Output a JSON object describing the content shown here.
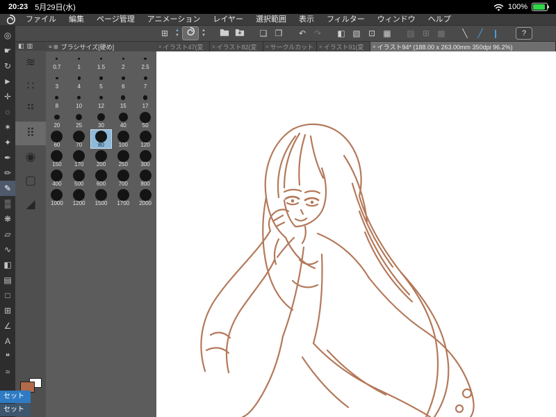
{
  "status_bar": {
    "time": "20:23",
    "date": "5月29日(水)",
    "battery_percent": "100%"
  },
  "menu_bar": {
    "items": [
      "ファイル",
      "編集",
      "ページ管理",
      "アニメーション",
      "レイヤー",
      "選択範囲",
      "表示",
      "フィルター",
      "ウィンドウ",
      "ヘルプ"
    ]
  },
  "toolbar": {
    "icons": [
      {
        "name": "palette-grid",
        "glyph": "⊞",
        "kind": "normal"
      },
      {
        "name": "tool-size-stepper",
        "glyph": "▲▼",
        "kind": "stepper",
        "accent": true
      },
      {
        "name": "current-tool-brush",
        "glyph": "logo",
        "kind": "active"
      },
      {
        "name": "brush-size-stepper",
        "glyph": "▲▼",
        "kind": "stepper"
      },
      {
        "name": "open-file",
        "glyph": "folder",
        "kind": "normal",
        "gap": true
      },
      {
        "name": "save-file",
        "glyph": "folder-arrow",
        "kind": "normal"
      },
      {
        "name": "new-page",
        "glyph": "❏",
        "kind": "normal",
        "gap": true
      },
      {
        "name": "duplicate-page",
        "glyph": "❐",
        "kind": "normal"
      },
      {
        "name": "undo",
        "glyph": "↶",
        "kind": "normal",
        "gap": true
      },
      {
        "name": "redo",
        "glyph": "↷",
        "kind": "dim"
      },
      {
        "name": "snap-ruler",
        "glyph": "◧",
        "kind": "normal",
        "gap": true
      },
      {
        "name": "snap-special-ruler",
        "glyph": "▧",
        "kind": "normal"
      },
      {
        "name": "snap-grid",
        "glyph": "⊡",
        "kind": "normal"
      },
      {
        "name": "material-palette",
        "glyph": "▦",
        "kind": "normal"
      },
      {
        "name": "selection-launcher",
        "glyph": "▨",
        "kind": "dim",
        "gap": true
      },
      {
        "name": "transform",
        "glyph": "⊞",
        "kind": "dim"
      },
      {
        "name": "mesh-transform",
        "glyph": "▩",
        "kind": "dim"
      },
      {
        "name": "line-tool",
        "glyph": "╲",
        "kind": "normal",
        "gap": true
      },
      {
        "name": "curve-tool",
        "glyph": "╱",
        "kind": "blue"
      },
      {
        "name": "pen-pressure",
        "glyph": "❙",
        "kind": "blue"
      }
    ],
    "help_label": "?"
  },
  "tabs": [
    {
      "label": "イラスト47(変",
      "active": false
    },
    {
      "label": "イラスト82(変",
      "active": false
    },
    {
      "label": "サークルカット",
      "active": false
    },
    {
      "label": "イラスト91(変",
      "active": false
    },
    {
      "label": "イラスト94* (188.00 x 263.00mm 350dpi 96.2%)",
      "active": true
    }
  ],
  "tool_palette": {
    "selected_index": 10,
    "tools": [
      {
        "name": "zoom",
        "glyph": "◎"
      },
      {
        "name": "hand",
        "glyph": "☛"
      },
      {
        "name": "rotate",
        "glyph": "↻"
      },
      {
        "name": "operate",
        "glyph": "►"
      },
      {
        "name": "move-layer",
        "glyph": "✛"
      },
      {
        "name": "lasso",
        "glyph": "◌"
      },
      {
        "name": "auto-select",
        "glyph": "✶"
      },
      {
        "name": "eyedropper",
        "glyph": "✦"
      },
      {
        "name": "pen",
        "glyph": "✒"
      },
      {
        "name": "pencil",
        "glyph": "✏"
      },
      {
        "name": "brush",
        "glyph": "✎"
      },
      {
        "name": "airbrush",
        "glyph": "▒"
      },
      {
        "name": "decoration",
        "glyph": "❋"
      },
      {
        "name": "eraser",
        "glyph": "▱"
      },
      {
        "name": "blend",
        "glyph": "∿"
      },
      {
        "name": "fill",
        "glyph": "◧"
      },
      {
        "name": "gradient",
        "glyph": "▤"
      },
      {
        "name": "figure",
        "glyph": "□"
      },
      {
        "name": "frame",
        "glyph": "⊞"
      },
      {
        "name": "ruler",
        "glyph": "∠"
      },
      {
        "name": "text",
        "glyph": "A"
      },
      {
        "name": "balloon",
        "glyph": "❝"
      },
      {
        "name": "correct-line",
        "glyph": "≈"
      }
    ]
  },
  "subtool_palette": {
    "selected_index": 3,
    "toggles": [
      "◧",
      "▥"
    ],
    "items": [
      {
        "name": "soft-pencil",
        "glyph": "≋"
      },
      {
        "name": "rough-pencil",
        "glyph": "∷"
      },
      {
        "name": "dot-brush-small",
        "glyph": "⠛"
      },
      {
        "name": "dot-brush-dense",
        "glyph": "⠿"
      },
      {
        "name": "round-brush",
        "glyph": "◉"
      },
      {
        "name": "flat-brush",
        "glyph": "▢"
      },
      {
        "name": "slanted-brush",
        "glyph": "◢"
      }
    ]
  },
  "brush_size_panel": {
    "title": "ブラシサイズ[硬め]",
    "header_icons": [
      "≡",
      "⊞"
    ],
    "selected_size": 80,
    "sizes": [
      0.7,
      1,
      1.5,
      2,
      2.5,
      3,
      4,
      5,
      6,
      7,
      8,
      10,
      12,
      15,
      17,
      20,
      25,
      30,
      40,
      50,
      60,
      70,
      80,
      100,
      120,
      150,
      170,
      200,
      250,
      300,
      400,
      500,
      600,
      700,
      800,
      1000,
      1200,
      1500,
      1700,
      2000
    ]
  },
  "color_area": {
    "main_color": "#b26a48",
    "sub_color": "#ffffff",
    "set_tabs": [
      {
        "label": "セット",
        "active": true
      },
      {
        "label": "セット",
        "active": false
      }
    ]
  },
  "colors": {
    "accent_blue": "#4a9fe0",
    "selected_cell": "#8fb9d9",
    "sketch": "#b4795a",
    "set_tab_blue": "#2e7bc4",
    "set_tab_dim": "#3d566e"
  }
}
